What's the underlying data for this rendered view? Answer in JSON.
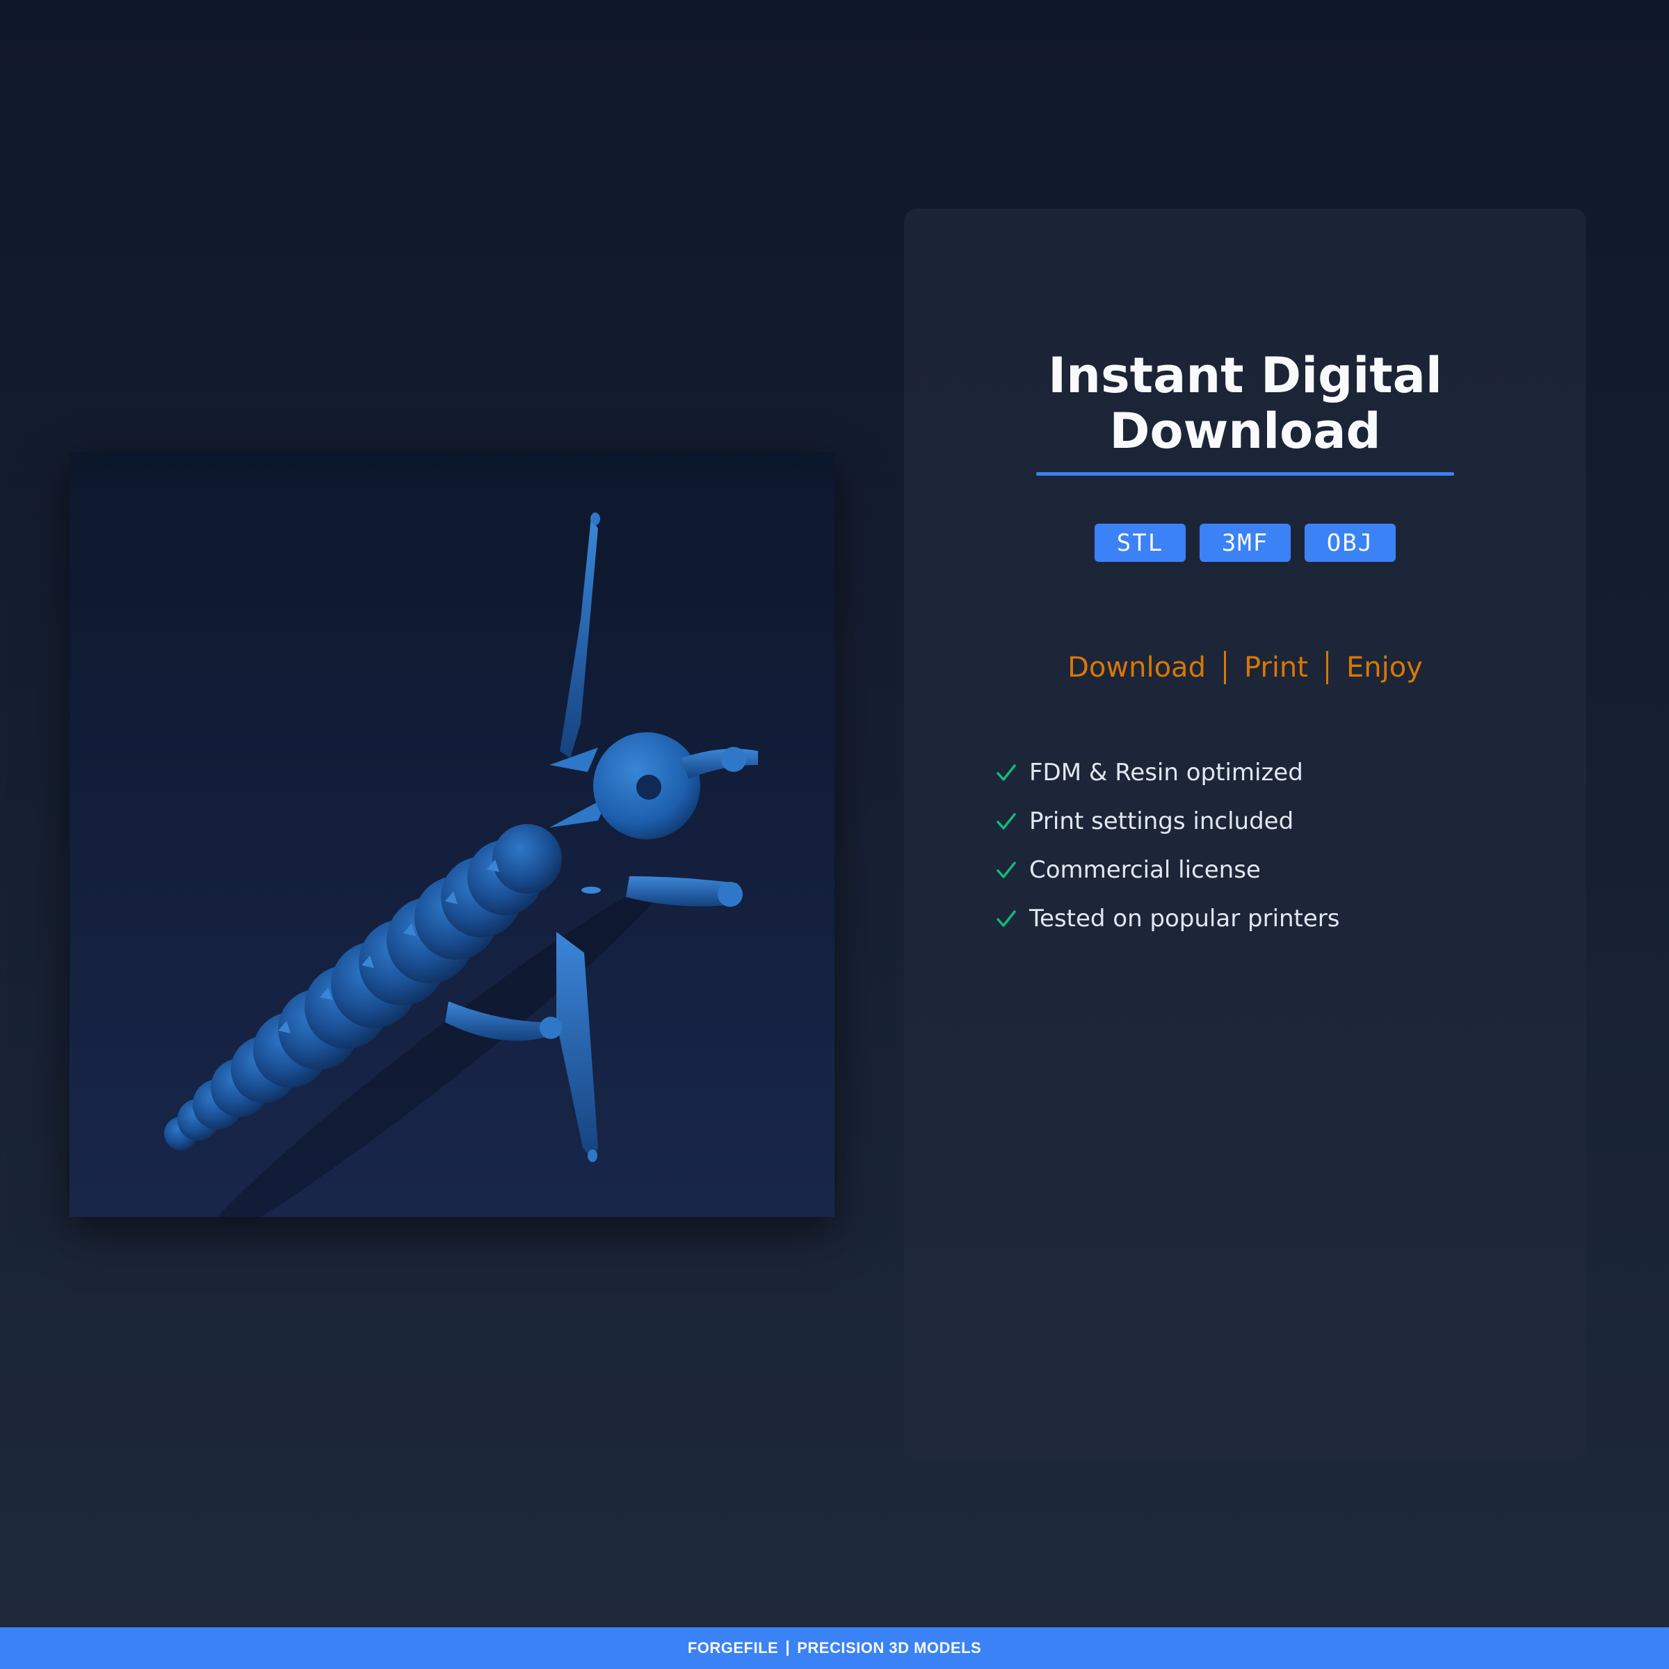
{
  "hero": {
    "title_line1": "Instant Digital",
    "title_line2": "Download"
  },
  "formats": [
    "STL",
    "3MF",
    "OBJ"
  ],
  "steps": [
    "Download",
    "Print",
    "Enjoy"
  ],
  "features": [
    "FDM & Resin optimized",
    "Print settings included",
    "Commercial license",
    "Tested on popular printers"
  ],
  "footer": {
    "brand": "FORGEFILE",
    "tagline": "PRECISION 3D MODELS"
  },
  "colors": {
    "accent": "#3b82f6",
    "step_text": "#d97706",
    "check": "#10b981",
    "model": "#1d5fae"
  },
  "icons": {
    "feature_bullet": "check-icon"
  }
}
